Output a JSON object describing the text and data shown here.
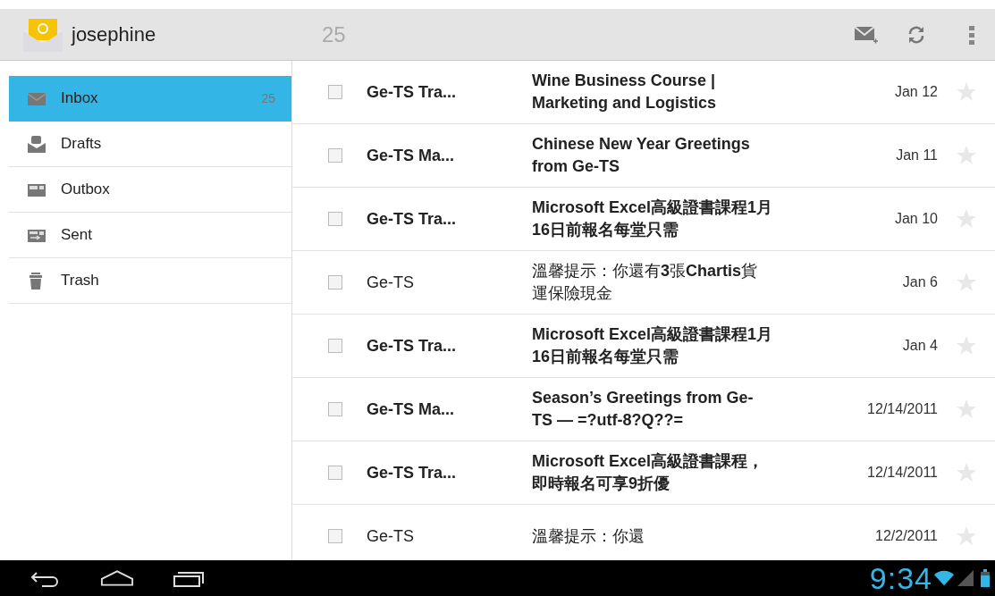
{
  "action_bar": {
    "account": "josephine",
    "unread_count": "25"
  },
  "sidebar": {
    "items": [
      {
        "label": "Inbox",
        "count": "25",
        "kind": "inbox",
        "selected": true
      },
      {
        "label": "Drafts",
        "kind": "drafts",
        "selected": false
      },
      {
        "label": "Outbox",
        "kind": "outbox",
        "selected": false
      },
      {
        "label": "Sent",
        "kind": "sent",
        "selected": false
      },
      {
        "label": "Trash",
        "kind": "trash",
        "selected": false
      }
    ]
  },
  "messages": [
    {
      "sender": "Ge-TS Tra...",
      "subject": "Wine Business Course | Marketing and Logistics",
      "date": "Jan 12",
      "unread": true,
      "checked": false,
      "starred": false
    },
    {
      "sender": "Ge-TS Ma...",
      "subject": "Chinese New Year Greetings from Ge-TS",
      "date": "Jan 11",
      "unread": true,
      "checked": false,
      "starred": false
    },
    {
      "sender": "Ge-TS Tra...",
      "subject": "**Microsoft Excel**高級證書課程**1**月**16**日前報名每堂只需",
      "date": "Jan 10",
      "unread": true,
      "checked": false,
      "starred": false
    },
    {
      "sender": "Ge-TS",
      "subject": "溫馨提示：你還有**3**張**Chartis**貨運保險現金",
      "date": "Jan 6",
      "unread": false,
      "checked": false,
      "starred": false
    },
    {
      "sender": "Ge-TS Tra...",
      "subject": "**Microsoft Excel**高級證書課程**1**月**16**日前報名每堂只需",
      "date": "Jan 4",
      "unread": true,
      "checked": false,
      "starred": false
    },
    {
      "sender": "Ge-TS Ma...",
      "subject": "**Season’s Greetings from Ge-TS** — =?utf-8?Q??=",
      "date": "12/14/2011",
      "unread": true,
      "checked": false,
      "starred": false
    },
    {
      "sender": "Ge-TS Tra...",
      "subject": "**Microsoft Excel**高級證書課程，即時報名可享**9**折優",
      "date": "12/14/2011",
      "unread": true,
      "checked": false,
      "starred": false
    },
    {
      "sender": "Ge-TS",
      "subject": "溫馨提示：你還",
      "date": "12/2/2011",
      "unread": false,
      "checked": false,
      "starred": false
    }
  ],
  "status_bar": {
    "time": "9:34"
  }
}
